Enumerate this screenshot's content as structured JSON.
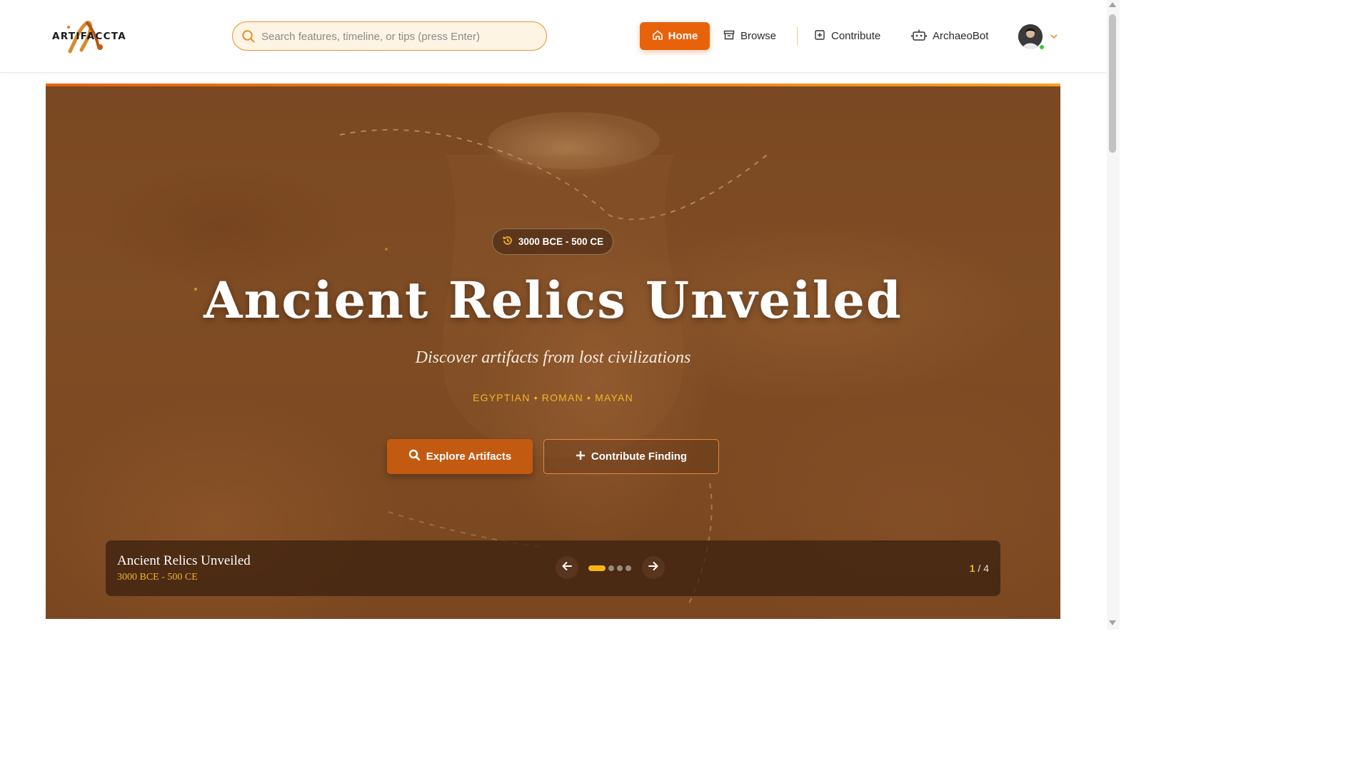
{
  "header": {
    "logo_text": "ARTIFACCTA",
    "search": {
      "placeholder": "Search features, timeline, or tips (press Enter)"
    },
    "nav": {
      "home": "Home",
      "browse": "Browse",
      "contribute": "Contribute",
      "archaeobot": "ArchaeoBot"
    },
    "user_status": "online"
  },
  "hero": {
    "period": "3000 BCE - 500 CE",
    "title": "Ancient Relics Unveiled",
    "subtitle": "Discover artifacts from lost civilizations",
    "tags": "EGYPTIAN • ROMAN • MAYAN",
    "explore_button": "Explore Artifacts",
    "contribute_button": "Contribute Finding",
    "slide": {
      "title": "Ancient Relics Unveiled",
      "period": "3000 BCE - 500 CE",
      "current": "1",
      "total": "/ 4"
    }
  },
  "colors": {
    "accent": "#e8620c",
    "gold": "#f2b52a",
    "hero_brown": "#7a4822"
  },
  "icons": [
    "search-icon",
    "home-icon",
    "archive-icon",
    "plus-square-icon",
    "robot-icon",
    "history-icon",
    "chevron-down-icon",
    "arrow-left-icon",
    "arrow-right-icon",
    "plus-icon"
  ]
}
